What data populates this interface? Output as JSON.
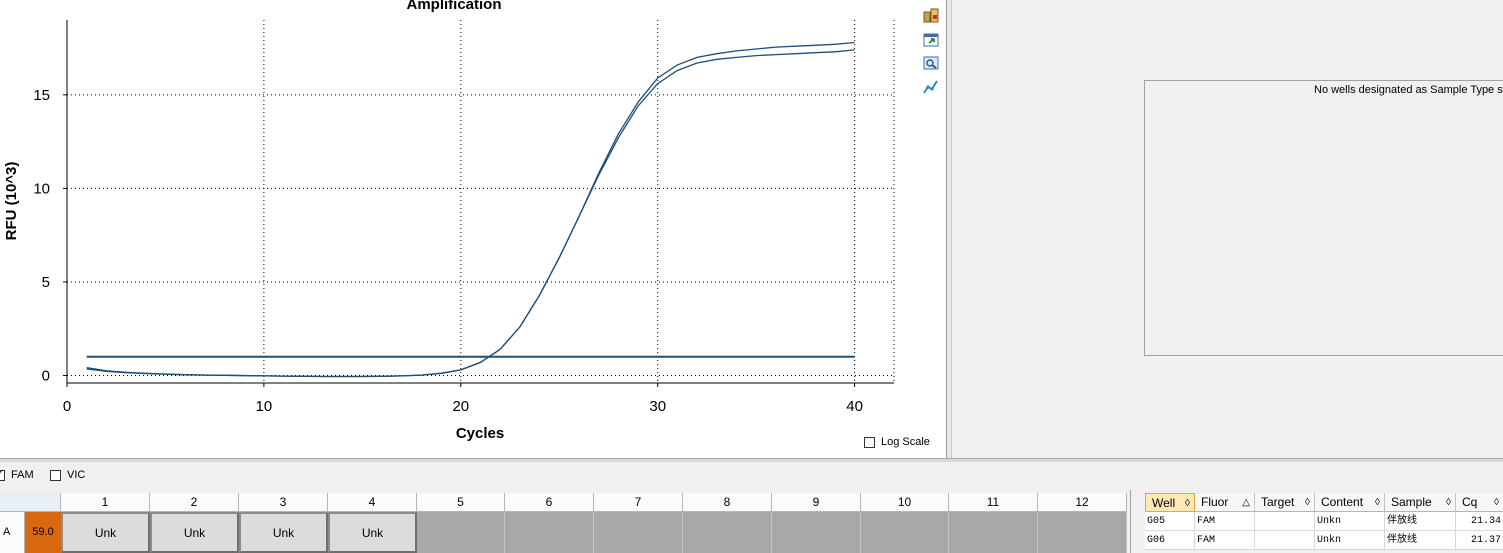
{
  "chart_data": {
    "type": "line",
    "title": "Amplification",
    "xlabel": "Cycles",
    "ylabel": "RFU (10^3)",
    "xlim": [
      0,
      42
    ],
    "ylim": [
      -0.4,
      19
    ],
    "xticks": [
      0,
      10,
      20,
      30,
      40
    ],
    "yticks": [
      0,
      5,
      10,
      15
    ],
    "grid": true,
    "line_color": "#1f4e79",
    "threshold": {
      "value": 1.0,
      "x": [
        1,
        40
      ]
    },
    "series": [
      {
        "x": [
          1,
          2,
          3,
          4,
          5,
          6,
          7,
          8,
          9,
          10,
          11,
          12,
          13,
          14,
          15,
          16,
          17,
          18,
          19,
          20,
          21,
          22,
          23,
          24,
          25,
          26,
          27,
          28,
          29,
          30,
          31,
          32,
          33,
          34,
          35,
          36,
          37,
          38,
          39,
          40
        ],
        "values": [
          0.42,
          0.25,
          0.17,
          0.12,
          0.08,
          0.05,
          0.03,
          0.01,
          0.0,
          -0.02,
          -0.03,
          -0.04,
          -0.05,
          -0.05,
          -0.05,
          -0.04,
          -0.02,
          0.02,
          0.12,
          0.3,
          0.7,
          1.4,
          2.6,
          4.3,
          6.3,
          8.5,
          10.7,
          12.7,
          14.4,
          15.6,
          16.3,
          16.7,
          16.9,
          17.0,
          17.1,
          17.15,
          17.2,
          17.25,
          17.3,
          17.4
        ]
      },
      {
        "x": [
          1,
          2,
          3,
          4,
          5,
          6,
          7,
          8,
          9,
          10,
          11,
          12,
          13,
          14,
          15,
          16,
          17,
          18,
          19,
          20,
          21,
          22,
          23,
          24,
          25,
          26,
          27,
          28,
          29,
          30,
          31,
          32,
          33,
          34,
          35,
          36,
          37,
          38,
          39,
          40
        ],
        "values": [
          0.35,
          0.22,
          0.15,
          0.1,
          0.07,
          0.04,
          0.02,
          0.01,
          -0.01,
          -0.02,
          -0.03,
          -0.04,
          -0.05,
          -0.05,
          -0.05,
          -0.04,
          -0.02,
          0.02,
          0.12,
          0.3,
          0.7,
          1.4,
          2.6,
          4.3,
          6.3,
          8.5,
          10.8,
          12.9,
          14.6,
          15.9,
          16.6,
          17.0,
          17.2,
          17.35,
          17.45,
          17.55,
          17.6,
          17.65,
          17.7,
          17.8
        ]
      }
    ]
  },
  "log_scale": {
    "label": "Log Scale",
    "checked": false
  },
  "standard_curve": {
    "message": "No wells designated as Sample Type standard"
  },
  "fluorophores": [
    {
      "label": "FAM",
      "checked": true
    },
    {
      "label": "VIC",
      "checked": false
    }
  ],
  "plate": {
    "columns": [
      "1",
      "2",
      "3",
      "4",
      "5",
      "6",
      "7",
      "8",
      "9",
      "10",
      "11",
      "12"
    ],
    "row_label": "A",
    "row_temp": "59.0",
    "row_temp_color": "#d9680e",
    "wells": [
      "Unk",
      "Unk",
      "Unk",
      "Unk",
      "",
      "",
      "",
      "",
      "",
      "",
      "",
      ""
    ]
  },
  "results_table": {
    "columns": [
      {
        "label": "Well",
        "sort": "◊"
      },
      {
        "label": "Fluor",
        "sort": "△"
      },
      {
        "label": "Target",
        "sort": "◊"
      },
      {
        "label": "Content",
        "sort": "◊"
      },
      {
        "label": "Sample",
        "sort": "◊"
      },
      {
        "label": "Cq",
        "sort": "◊"
      }
    ],
    "rows": [
      {
        "well": "G05",
        "fluor": "FAM",
        "target": "",
        "content": "Unkn",
        "sample": "伴放线",
        "cq": "21.34"
      },
      {
        "well": "G06",
        "fluor": "FAM",
        "target": "",
        "content": "Unkn",
        "sample": "伴放线",
        "cq": "21.37"
      }
    ]
  }
}
